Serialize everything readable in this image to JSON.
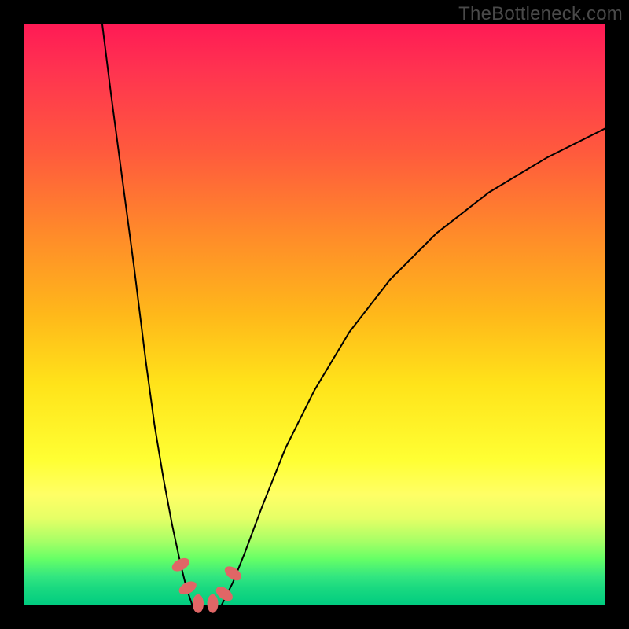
{
  "watermark": "TheBottleneck.com",
  "colors": {
    "frame": "#000000",
    "marker": "#e06666",
    "curve": "#000000"
  },
  "chart_data": {
    "type": "line",
    "title": "",
    "xlabel": "",
    "ylabel": "",
    "xlim": [
      0,
      100
    ],
    "ylim": [
      0,
      100
    ],
    "grid": false,
    "legend": false,
    "series": [
      {
        "name": "left-branch",
        "x": [
          13.5,
          15,
          17,
          19,
          21,
          22.5,
          24,
          25.5,
          27,
          28,
          29
        ],
        "y": [
          100,
          88,
          73,
          58,
          42,
          31,
          22,
          14,
          7,
          3,
          0
        ]
      },
      {
        "name": "floor",
        "x": [
          29,
          30,
          31,
          32,
          33,
          34
        ],
        "y": [
          0,
          0,
          0,
          0,
          0,
          0
        ]
      },
      {
        "name": "right-branch",
        "x": [
          34,
          36,
          38,
          41,
          45,
          50,
          56,
          63,
          71,
          80,
          90,
          100
        ],
        "y": [
          0,
          4,
          9,
          17,
          27,
          37,
          47,
          56,
          64,
          71,
          77,
          82
        ]
      }
    ],
    "markers": [
      {
        "x": 27.0,
        "y": 7.0,
        "angle_deg": 62
      },
      {
        "x": 28.2,
        "y": 3.0,
        "angle_deg": 62
      },
      {
        "x": 30.0,
        "y": 0.3,
        "angle_deg": 0
      },
      {
        "x": 32.5,
        "y": 0.3,
        "angle_deg": 0
      },
      {
        "x": 34.5,
        "y": 2.0,
        "angle_deg": -55
      },
      {
        "x": 36.0,
        "y": 5.5,
        "angle_deg": -55
      }
    ],
    "marker_shape": {
      "rx": 7,
      "ry": 12
    }
  }
}
